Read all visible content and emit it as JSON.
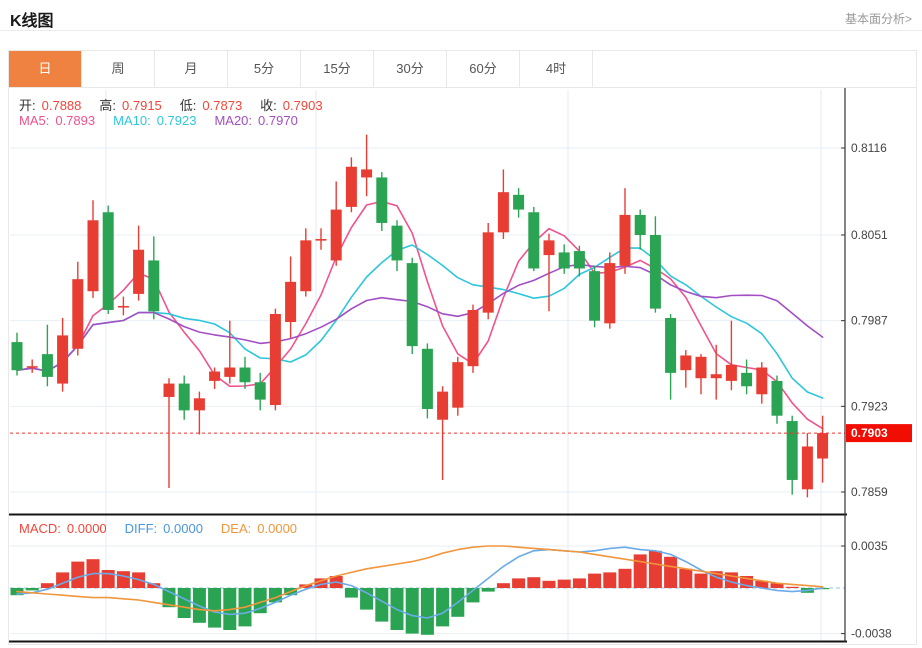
{
  "header": {
    "title": "K线图",
    "link": "基本面分析>"
  },
  "tabs": {
    "items": [
      {
        "label": "日",
        "active": true
      },
      {
        "label": "周",
        "active": false
      },
      {
        "label": "月",
        "active": false
      },
      {
        "label": "5分",
        "active": false
      },
      {
        "label": "15分",
        "active": false
      },
      {
        "label": "30分",
        "active": false
      },
      {
        "label": "60分",
        "active": false
      },
      {
        "label": "4时",
        "active": false
      }
    ],
    "active_bg": "#ef8240"
  },
  "legend": {
    "ohlc": [
      {
        "label": "开:",
        "value": "0.7888"
      },
      {
        "label": "高:",
        "value": "0.7915"
      },
      {
        "label": "低:",
        "value": "0.7873"
      },
      {
        "label": "收:",
        "value": "0.7903"
      }
    ],
    "ohlc_value_color": "#f2463a",
    "ma": [
      {
        "label": "MA5:",
        "value": "0.7893",
        "color": "#f0538d"
      },
      {
        "label": "MA10:",
        "value": "0.7923",
        "color": "#2ec6dc"
      },
      {
        "label": "MA20:",
        "value": "0.7970",
        "color": "#a34fc3"
      }
    ],
    "macd": [
      {
        "label": "MACD:",
        "value": "0.0000",
        "color": "#f2463a"
      },
      {
        "label": "DIFF:",
        "value": "0.0000",
        "color": "#4a97e0"
      },
      {
        "label": "DEA:",
        "value": "0.0000",
        "color": "#f0963c"
      }
    ]
  },
  "chart_data": {
    "type": "candlestick+macd",
    "title": "K线图",
    "main": {
      "ylabels": [
        0.8116,
        0.8051,
        0.7987,
        0.7923,
        0.7859
      ],
      "last_price": 0.7903,
      "ma_periods": [
        5,
        10,
        20
      ],
      "candles": [
        [
          0.7971,
          0.7978,
          0.7946,
          0.795
        ],
        [
          0.7953,
          0.7958,
          0.7948,
          0.7953
        ],
        [
          0.7962,
          0.7984,
          0.7938,
          0.7945
        ],
        [
          0.794,
          0.7989,
          0.7934,
          0.7976
        ],
        [
          0.7966,
          0.8031,
          0.7961,
          0.8018
        ],
        [
          0.8009,
          0.8077,
          0.8004,
          0.8062
        ],
        [
          0.8068,
          0.8073,
          0.7992,
          0.7995
        ],
        [
          0.7997,
          0.8005,
          0.7991,
          0.7998
        ],
        [
          0.8007,
          0.8058,
          0.8002,
          0.804
        ],
        [
          0.8032,
          0.805,
          0.7988,
          0.7994
        ],
        [
          0.793,
          0.7944,
          0.7862,
          0.794
        ],
        [
          0.794,
          0.7946,
          0.7913,
          0.792
        ],
        [
          0.792,
          0.7934,
          0.7902,
          0.7929
        ],
        [
          0.7942,
          0.7952,
          0.7936,
          0.7949
        ],
        [
          0.7945,
          0.7987,
          0.794,
          0.7952
        ],
        [
          0.7952,
          0.796,
          0.7936,
          0.7941
        ],
        [
          0.7941,
          0.7948,
          0.792,
          0.7928
        ],
        [
          0.7924,
          0.7996,
          0.792,
          0.7992
        ],
        [
          0.7986,
          0.8035,
          0.7974,
          0.8016
        ],
        [
          0.8009,
          0.8056,
          0.8005,
          0.8047
        ],
        [
          0.8047,
          0.8056,
          0.804,
          0.8048
        ],
        [
          0.8032,
          0.8091,
          0.8028,
          0.807
        ],
        [
          0.8072,
          0.8109,
          0.8068,
          0.8102
        ],
        [
          0.8094,
          0.8126,
          0.808,
          0.81
        ],
        [
          0.8094,
          0.8098,
          0.8054,
          0.806
        ],
        [
          0.8058,
          0.8062,
          0.8024,
          0.8032
        ],
        [
          0.803,
          0.8034,
          0.7962,
          0.7968
        ],
        [
          0.7966,
          0.797,
          0.7914,
          0.7921
        ],
        [
          0.7913,
          0.7938,
          0.7868,
          0.7934
        ],
        [
          0.7922,
          0.796,
          0.7916,
          0.7956
        ],
        [
          0.7953,
          0.7999,
          0.7948,
          0.7995
        ],
        [
          0.7993,
          0.806,
          0.7988,
          0.8053
        ],
        [
          0.8053,
          0.81,
          0.8048,
          0.8083
        ],
        [
          0.8081,
          0.8086,
          0.8064,
          0.807
        ],
        [
          0.8068,
          0.8072,
          0.8024,
          0.8026
        ],
        [
          0.8036,
          0.8052,
          0.7994,
          0.8047
        ],
        [
          0.8038,
          0.8044,
          0.8022,
          0.8026
        ],
        [
          0.8039,
          0.8043,
          0.802,
          0.8026
        ],
        [
          0.8024,
          0.8028,
          0.7982,
          0.7987
        ],
        [
          0.7985,
          0.8038,
          0.7981,
          0.803
        ],
        [
          0.8028,
          0.8086,
          0.8022,
          0.8066
        ],
        [
          0.8066,
          0.807,
          0.804,
          0.8051
        ],
        [
          0.8051,
          0.8065,
          0.7993,
          0.7996
        ],
        [
          0.7989,
          0.7992,
          0.7928,
          0.7948
        ],
        [
          0.795,
          0.7965,
          0.7937,
          0.7961
        ],
        [
          0.7944,
          0.7962,
          0.7932,
          0.796
        ],
        [
          0.7944,
          0.7969,
          0.7928,
          0.7947
        ],
        [
          0.7942,
          0.7987,
          0.7935,
          0.7954
        ],
        [
          0.7948,
          0.7958,
          0.7932,
          0.7938
        ],
        [
          0.7932,
          0.7956,
          0.7925,
          0.7952
        ],
        [
          0.7942,
          0.7946,
          0.791,
          0.7916
        ],
        [
          0.7912,
          0.7916,
          0.7857,
          0.7868
        ],
        [
          0.7861,
          0.7903,
          0.7855,
          0.7893
        ],
        [
          0.7884,
          0.7916,
          0.7866,
          0.7903
        ]
      ]
    },
    "macd": {
      "ylabels": [
        0.0035,
        -0.0038
      ],
      "hist": [
        -0.0006,
        -0.0002,
        0.0004,
        0.0013,
        0.0022,
        0.0024,
        0.0015,
        0.0014,
        0.0013,
        0.0004,
        -0.0016,
        -0.0025,
        -0.0029,
        -0.0033,
        -0.0035,
        -0.0032,
        -0.0021,
        -0.0012,
        -0.0006,
        0.0003,
        0.0008,
        0.001,
        -0.0008,
        -0.0018,
        -0.0028,
        -0.0035,
        -0.0038,
        -0.0039,
        -0.0032,
        -0.0024,
        -0.0012,
        -0.0003,
        0.0004,
        0.0008,
        0.0009,
        0.0006,
        0.0007,
        0.0008,
        0.0012,
        0.0013,
        0.0016,
        0.0028,
        0.0031,
        0.0026,
        0.0016,
        0.0012,
        0.0014,
        0.0013,
        0.001,
        0.0006,
        0.0004,
        0.0001,
        -0.0004,
        -0.0001
      ],
      "diff": [
        -0.0005,
        -0.0004,
        -0.0001,
        0.0004,
        0.0009,
        0.0012,
        0.0012,
        0.001,
        0.0007,
        0.0003,
        -0.0003,
        -0.0009,
        -0.0015,
        -0.002,
        -0.0022,
        -0.0021,
        -0.0017,
        -0.0012,
        -0.0006,
        -0.0001,
        0.0003,
        0.0005,
        0.0002,
        -0.0004,
        -0.0011,
        -0.0018,
        -0.0023,
        -0.0025,
        -0.0021,
        -0.0012,
        -0.0002,
        0.0008,
        0.0018,
        0.0026,
        0.0031,
        0.0032,
        0.0031,
        0.003,
        0.0031,
        0.0033,
        0.0034,
        0.0032,
        0.0031,
        0.0028,
        0.0022,
        0.0015,
        0.0009,
        0.0005,
        0.0002,
        0.0,
        -0.0002,
        -0.0003,
        -0.0002,
        0.0
      ],
      "dea": [
        -0.0003,
        -0.0004,
        -0.0005,
        -0.0006,
        -0.0007,
        -0.0008,
        -0.0008,
        -0.0009,
        -0.001,
        -0.0012,
        -0.0014,
        -0.0016,
        -0.0018,
        -0.0019,
        -0.0018,
        -0.0016,
        -0.0012,
        -0.0008,
        -0.0003,
        0.0002,
        0.0006,
        0.001,
        0.0013,
        0.0016,
        0.0018,
        0.002,
        0.0022,
        0.0025,
        0.0029,
        0.0032,
        0.0034,
        0.0035,
        0.0035,
        0.0034,
        0.0033,
        0.0032,
        0.0031,
        0.003,
        0.0028,
        0.0026,
        0.0024,
        0.0022,
        0.002,
        0.0018,
        0.0016,
        0.0014,
        0.0012,
        0.001,
        0.0008,
        0.0006,
        0.0004,
        0.0003,
        0.0002,
        0.0001
      ]
    },
    "colors": {
      "up": "#e73d33",
      "down": "#2aa452",
      "ma5": "#f0538d",
      "ma10": "#2ec6dc",
      "ma20": "#a34fc3",
      "diff_line": "#6babe8",
      "dea_line": "#f0963c",
      "badge": "#f20d02",
      "badge_text": "#ffffff",
      "grid": "#e9eff5",
      "vgrid": "#e3ebf3",
      "axis": "#333333",
      "label": "#444444",
      "price_line": "#f3302a",
      "zero_dash": "#b9d8ea",
      "separator": "#151515"
    },
    "layout_hints": {
      "grid": true,
      "legend_position": "top-left",
      "x_axis_labels": false
    }
  }
}
